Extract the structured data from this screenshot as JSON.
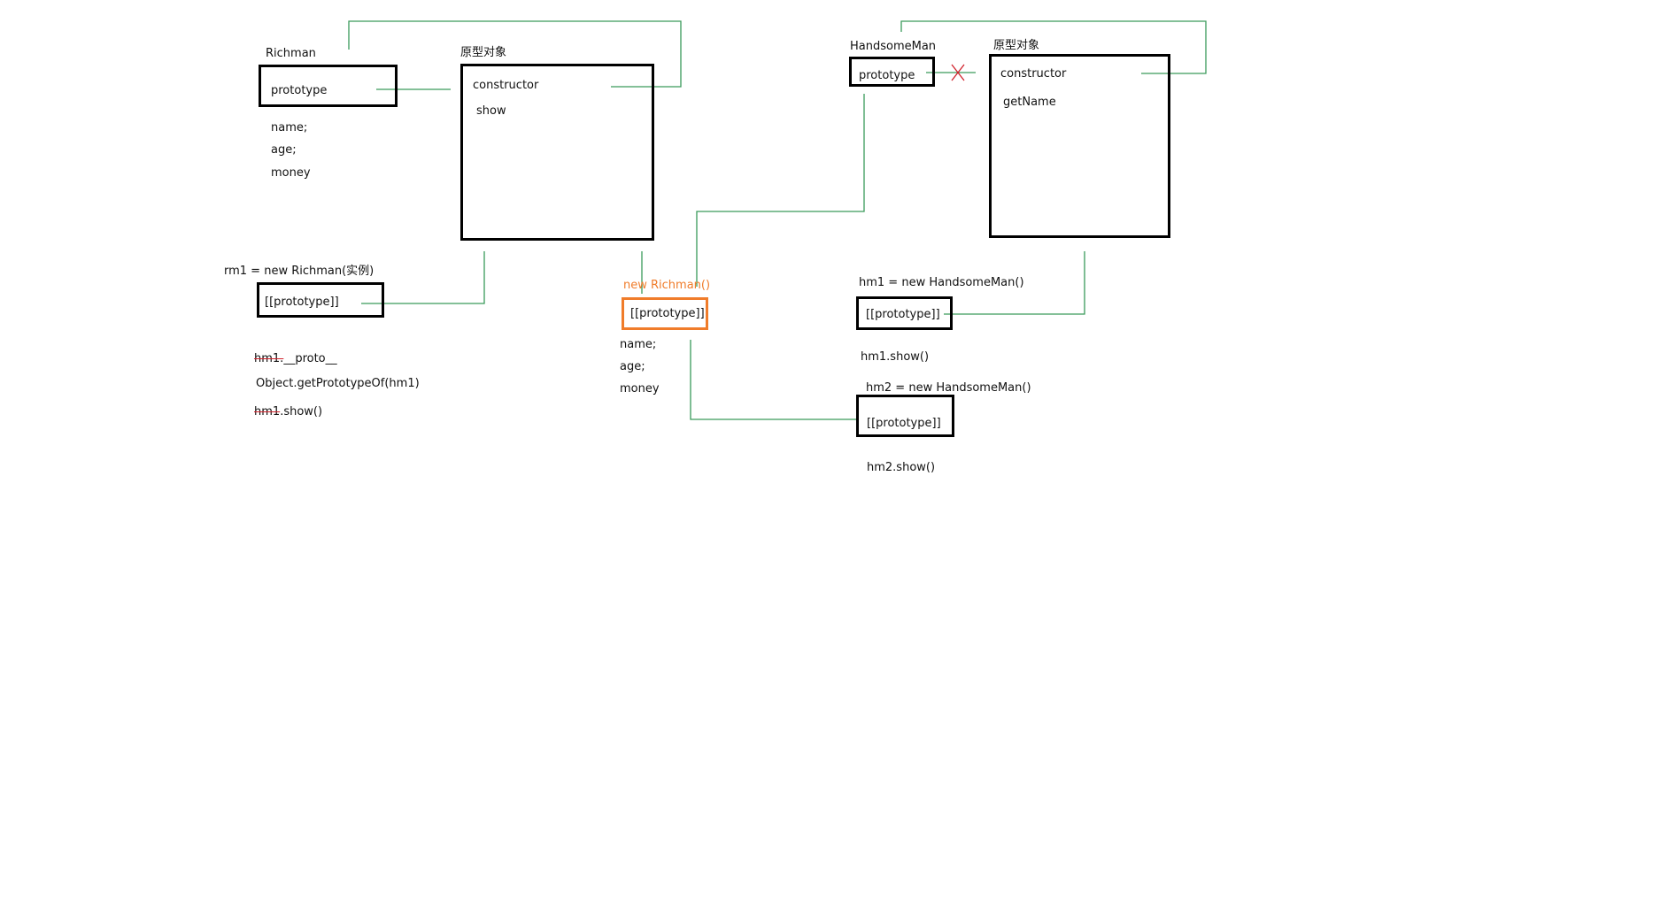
{
  "colors": {
    "connector": "#3a9a5b",
    "highlight": "#f07c2a",
    "strike": "#d0202a",
    "box_border": "#000000"
  },
  "richman": {
    "label": "Richman",
    "prototype": "prototype",
    "props": [
      "name;",
      "age;",
      "money"
    ],
    "proto_object": {
      "label": "原型对象",
      "members": [
        "constructor",
        "show"
      ]
    },
    "instance": {
      "label": "rm1  = new Richman(实例)",
      "slot": "[[prototype]]"
    },
    "notes": {
      "strike1": "hm1.",
      "proto": "__proto__",
      "getproto": "Object.getPrototypeOf(hm1)",
      "strike2": "hm1",
      "show": ".show()"
    }
  },
  "new_richman": {
    "label": "new Richman()",
    "slot": "[[prototype]]",
    "props": [
      "name;",
      "age;",
      "money"
    ]
  },
  "handsome": {
    "label": "HandsomeMan",
    "prototype": "prototype",
    "broken_link_icon": "x-mark",
    "proto_object": {
      "label": "原型对象",
      "members": [
        "constructor",
        "getName"
      ]
    },
    "hm1": {
      "label": "hm1  = new HandsomeMan()",
      "slot": "[[prototype]]",
      "call": "hm1.show()"
    },
    "hm2": {
      "label": "hm2  = new HandsomeMan()",
      "slot": "[[prototype]]",
      "call": "hm2.show()"
    }
  }
}
